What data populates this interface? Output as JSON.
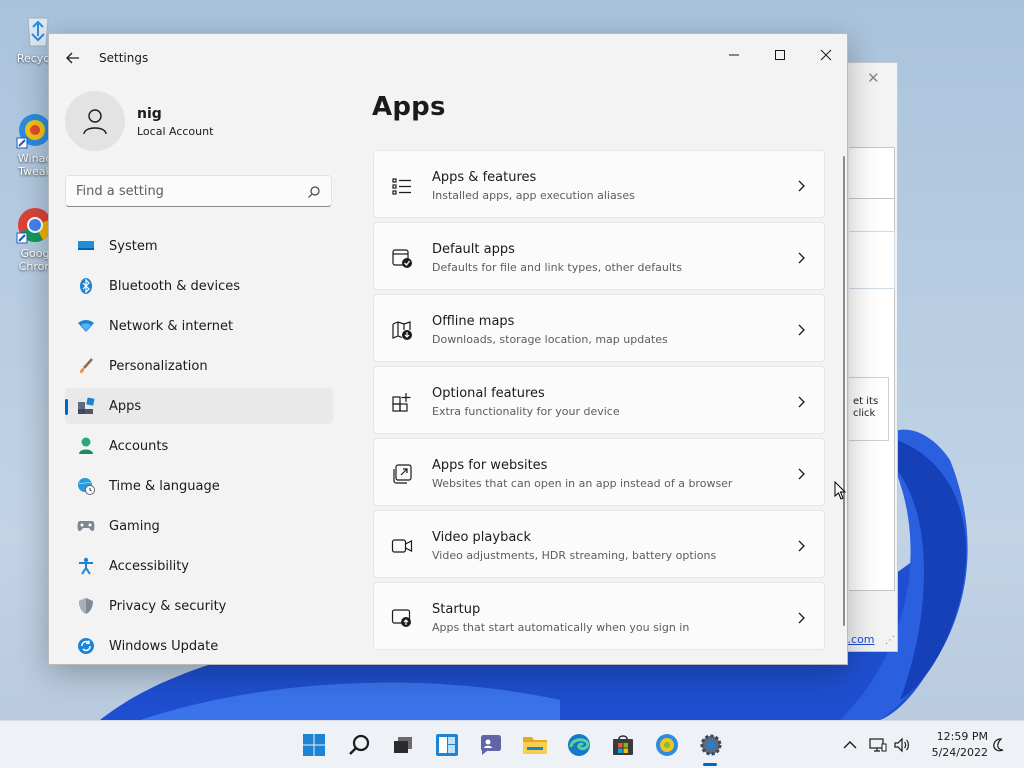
{
  "desktop": {
    "icons": [
      {
        "label": "Recycle",
        "icon": "recycle-bin-icon"
      },
      {
        "label": "Winae",
        "label2": "Tweak",
        "icon": "winaero-tweaker-icon"
      },
      {
        "label": "Goog",
        "label2": "Chron",
        "icon": "chrome-icon"
      }
    ]
  },
  "bg_window": {
    "partial_text": "et its click",
    "link": "o.com"
  },
  "settings": {
    "window_title": "Settings",
    "user": {
      "name": "nig",
      "account_type": "Local Account"
    },
    "search": {
      "placeholder": "Find a setting",
      "value": ""
    },
    "nav": [
      {
        "label": "System",
        "icon": "monitor-icon",
        "active": false
      },
      {
        "label": "Bluetooth & devices",
        "icon": "bluetooth-icon",
        "active": false
      },
      {
        "label": "Network & internet",
        "icon": "wifi-icon",
        "active": false
      },
      {
        "label": "Personalization",
        "icon": "brush-icon",
        "active": false
      },
      {
        "label": "Apps",
        "icon": "apps-icon",
        "active": true
      },
      {
        "label": "Accounts",
        "icon": "person-icon",
        "active": false
      },
      {
        "label": "Time & language",
        "icon": "globe-clock-icon",
        "active": false
      },
      {
        "label": "Gaming",
        "icon": "gamepad-icon",
        "active": false
      },
      {
        "label": "Accessibility",
        "icon": "accessibility-icon",
        "active": false
      },
      {
        "label": "Privacy & security",
        "icon": "shield-icon",
        "active": false
      },
      {
        "label": "Windows Update",
        "icon": "update-icon",
        "active": false
      }
    ],
    "page_title": "Apps",
    "cards": [
      {
        "title": "Apps & features",
        "subtitle": "Installed apps, app execution aliases",
        "icon": "list-icon"
      },
      {
        "title": "Default apps",
        "subtitle": "Defaults for file and link types, other defaults",
        "icon": "default-apps-icon"
      },
      {
        "title": "Offline maps",
        "subtitle": "Downloads, storage location, map updates",
        "icon": "map-icon"
      },
      {
        "title": "Optional features",
        "subtitle": "Extra functionality for your device",
        "icon": "grid-plus-icon"
      },
      {
        "title": "Apps for websites",
        "subtitle": "Websites that can open in an app instead of a browser",
        "icon": "open-external-icon"
      },
      {
        "title": "Video playback",
        "subtitle": "Video adjustments, HDR streaming, battery options",
        "icon": "video-camera-icon"
      },
      {
        "title": "Startup",
        "subtitle": "Apps that start automatically when you sign in",
        "icon": "startup-icon"
      }
    ]
  },
  "taskbar": {
    "apps": [
      "start-icon",
      "search-icon",
      "task-view-icon",
      "widgets-icon",
      "chat-icon",
      "file-explorer-icon",
      "edge-icon",
      "store-icon",
      "winaero-icon",
      "settings-gear-icon"
    ],
    "time": "12:59 PM",
    "date": "5/24/2022"
  },
  "colors": {
    "accent": "#0067c0",
    "window_bg": "#f3f3f3",
    "card_bg": "#fbfbfb"
  }
}
